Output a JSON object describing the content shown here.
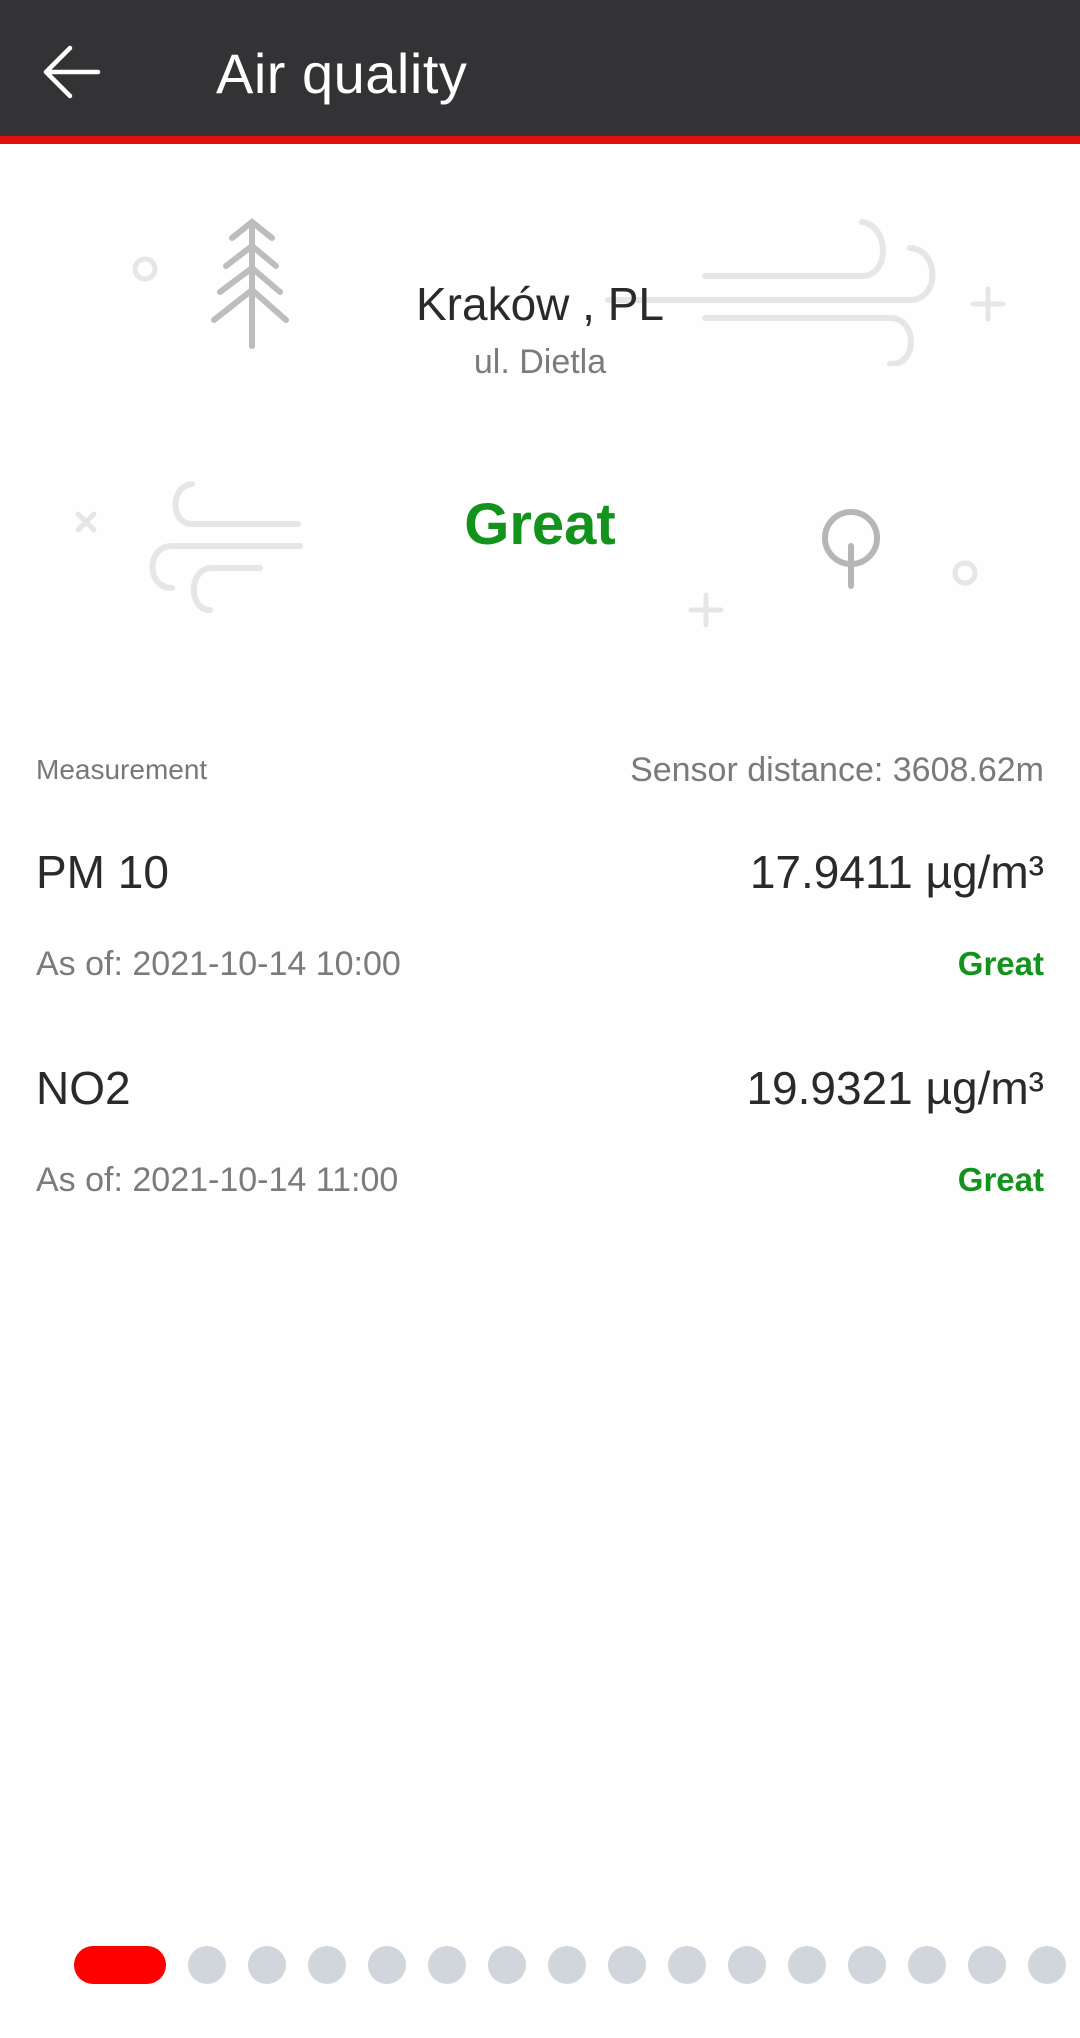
{
  "appbar": {
    "title": "Air quality",
    "back_icon": "arrow-left-icon",
    "accent_color": "#e01010"
  },
  "location": {
    "city": "Kraków , PL",
    "street": "ul. Dietla"
  },
  "overall": {
    "status": "Great",
    "color": "#11931c"
  },
  "measurements": {
    "header_label": "Measurement",
    "sensor_distance": "Sensor distance: 3608.62m",
    "items": [
      {
        "name": "PM 10",
        "value": "17.9411 µg/m³",
        "as_of": "As of: 2021-10-14 10:00",
        "status": "Great"
      },
      {
        "name": "NO2",
        "value": "19.9321 µg/m³",
        "as_of": "As of: 2021-10-14 11:00",
        "status": "Great"
      }
    ]
  },
  "pager": {
    "total_pages": 16,
    "current_page": 1,
    "active_color": "#fe0000",
    "inactive_color": "#d1d6dd"
  },
  "decorations": [
    "tree-icon",
    "wind-icon",
    "wind-icon",
    "tree-round-icon",
    "circle-icon",
    "plus-icon",
    "cross-icon"
  ]
}
